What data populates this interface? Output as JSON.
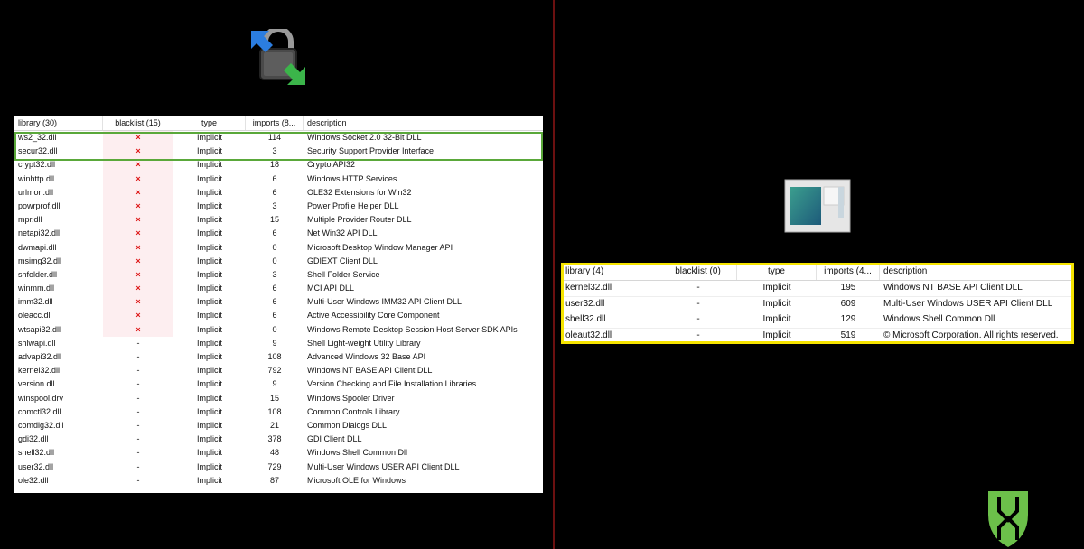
{
  "left_table": {
    "headers": {
      "library": "library (30)",
      "blacklist": "blacklist (15)",
      "type": "type",
      "imports": "imports (8...",
      "description": "description"
    },
    "rows": [
      {
        "library": "ws2_32.dll",
        "blacklist": "×",
        "type": "Implicit",
        "imports": "114",
        "description": "Windows Socket 2.0 32-Bit DLL"
      },
      {
        "library": "secur32.dll",
        "blacklist": "×",
        "type": "Implicit",
        "imports": "3",
        "description": "Security Support Provider Interface"
      },
      {
        "library": "crypt32.dll",
        "blacklist": "×",
        "type": "Implicit",
        "imports": "18",
        "description": "Crypto API32"
      },
      {
        "library": "winhttp.dll",
        "blacklist": "×",
        "type": "Implicit",
        "imports": "6",
        "description": "Windows HTTP Services"
      },
      {
        "library": "urlmon.dll",
        "blacklist": "×",
        "type": "Implicit",
        "imports": "6",
        "description": "OLE32 Extensions for Win32"
      },
      {
        "library": "powrprof.dll",
        "blacklist": "×",
        "type": "Implicit",
        "imports": "3",
        "description": "Power Profile Helper DLL"
      },
      {
        "library": "mpr.dll",
        "blacklist": "×",
        "type": "Implicit",
        "imports": "15",
        "description": "Multiple Provider Router DLL"
      },
      {
        "library": "netapi32.dll",
        "blacklist": "×",
        "type": "Implicit",
        "imports": "6",
        "description": "Net Win32 API DLL"
      },
      {
        "library": "dwmapi.dll",
        "blacklist": "×",
        "type": "Implicit",
        "imports": "0",
        "description": "Microsoft Desktop Window Manager API"
      },
      {
        "library": "msimg32.dll",
        "blacklist": "×",
        "type": "Implicit",
        "imports": "0",
        "description": "GDIEXT Client DLL"
      },
      {
        "library": "shfolder.dll",
        "blacklist": "×",
        "type": "Implicit",
        "imports": "3",
        "description": "Shell Folder Service"
      },
      {
        "library": "winmm.dll",
        "blacklist": "×",
        "type": "Implicit",
        "imports": "6",
        "description": "MCI API DLL"
      },
      {
        "library": "imm32.dll",
        "blacklist": "×",
        "type": "Implicit",
        "imports": "6",
        "description": "Multi-User Windows IMM32 API Client DLL"
      },
      {
        "library": "oleacc.dll",
        "blacklist": "×",
        "type": "Implicit",
        "imports": "6",
        "description": "Active Accessibility Core Component"
      },
      {
        "library": "wtsapi32.dll",
        "blacklist": "×",
        "type": "Implicit",
        "imports": "0",
        "description": "Windows Remote Desktop Session Host Server SDK APIs"
      },
      {
        "library": "shlwapi.dll",
        "blacklist": "-",
        "type": "Implicit",
        "imports": "9",
        "description": "Shell Light-weight Utility Library"
      },
      {
        "library": "advapi32.dll",
        "blacklist": "-",
        "type": "Implicit",
        "imports": "108",
        "description": "Advanced Windows 32 Base API"
      },
      {
        "library": "kernel32.dll",
        "blacklist": "-",
        "type": "Implicit",
        "imports": "792",
        "description": "Windows NT BASE API Client DLL"
      },
      {
        "library": "version.dll",
        "blacklist": "-",
        "type": "Implicit",
        "imports": "9",
        "description": "Version Checking and File Installation Libraries"
      },
      {
        "library": "winspool.drv",
        "blacklist": "-",
        "type": "Implicit",
        "imports": "15",
        "description": "Windows Spooler Driver"
      },
      {
        "library": "comctl32.dll",
        "blacklist": "-",
        "type": "Implicit",
        "imports": "108",
        "description": "Common Controls Library"
      },
      {
        "library": "comdlg32.dll",
        "blacklist": "-",
        "type": "Implicit",
        "imports": "21",
        "description": "Common Dialogs DLL"
      },
      {
        "library": "gdi32.dll",
        "blacklist": "-",
        "type": "Implicit",
        "imports": "378",
        "description": "GDI Client DLL"
      },
      {
        "library": "shell32.dll",
        "blacklist": "-",
        "type": "Implicit",
        "imports": "48",
        "description": "Windows Shell Common Dll"
      },
      {
        "library": "user32.dll",
        "blacklist": "-",
        "type": "Implicit",
        "imports": "729",
        "description": "Multi-User Windows USER API Client DLL"
      },
      {
        "library": "ole32.dll",
        "blacklist": "-",
        "type": "Implicit",
        "imports": "87",
        "description": "Microsoft OLE for Windows"
      }
    ]
  },
  "right_table": {
    "headers": {
      "library": "library (4)",
      "blacklist": "blacklist (0)",
      "type": "type",
      "imports": "imports (4...",
      "description": "description"
    },
    "rows": [
      {
        "library": "kernel32.dll",
        "blacklist": "-",
        "type": "Implicit",
        "imports": "195",
        "description": "Windows NT BASE API Client DLL"
      },
      {
        "library": "user32.dll",
        "blacklist": "-",
        "type": "Implicit",
        "imports": "609",
        "description": "Multi-User Windows USER API Client DLL"
      },
      {
        "library": "shell32.dll",
        "blacklist": "-",
        "type": "Implicit",
        "imports": "129",
        "description": "Windows Shell Common Dll"
      },
      {
        "library": "oleaut32.dll",
        "blacklist": "-",
        "type": "Implicit",
        "imports": "519",
        "description": "© Microsoft Corporation. All rights reserved."
      }
    ]
  },
  "colors": {
    "highlight_green": "#5aa83a",
    "highlight_yellow": "#f5e400",
    "blacklist_mark": "#dd1111",
    "divider": "#6b1010",
    "brand_green": "#6cc04a"
  },
  "icons": {
    "left": "winscp-lock-icon",
    "right": "application-window-icon",
    "brand": "cylance-logo-icon"
  }
}
